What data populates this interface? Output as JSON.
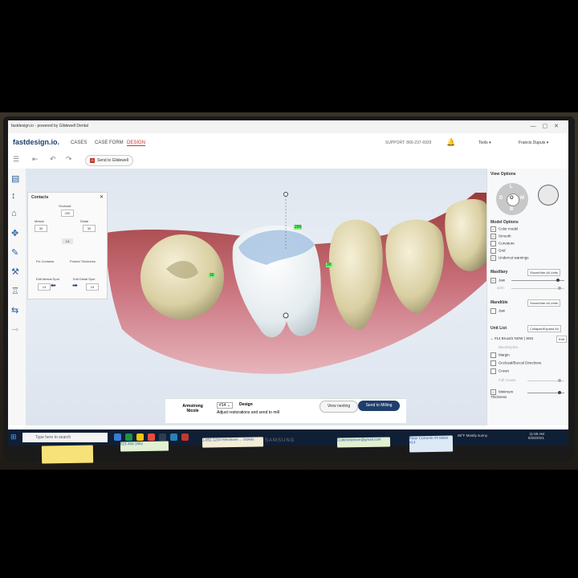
{
  "window": {
    "title": "fastdesign.io - powered by Glidewell Dental"
  },
  "app": {
    "logo": "fastdesign.io.",
    "tabs": [
      "CASES",
      "CASE FORM",
      "DESIGN"
    ],
    "active_tab": "DESIGN",
    "support": "SUPPORT: 866-237-6929",
    "tools": "Tools",
    "user": "Francis Dupuis"
  },
  "toolbar": {
    "send": "Send to Glidewell"
  },
  "contacts": {
    "title": "Contacts",
    "occlusal_label": "Occlusal",
    "occlusal_value": "200",
    "mesial_label": "Mesial",
    "mesial_value": "30",
    "distal_label": "Distal",
    "distal_value": "30",
    "center_value": "14",
    "fix_contacts": "Fix Contacts",
    "protect_thickness": "Protect Thickness",
    "edit_mesial": "Edit Mesial Spot",
    "edit_distal": "Edit Distal Spot",
    "mesial_spot": "13",
    "distal_spot": "15"
  },
  "viewport_labels": {
    "occlusal": "200",
    "mesial": "30",
    "distal": "30"
  },
  "right_panel": {
    "view_options": "View Options",
    "dial": {
      "top": "L",
      "left": "D",
      "center": "O",
      "right": "M",
      "bottom": "B"
    },
    "model_options": "Model Options",
    "model_items": [
      {
        "label": "Color model",
        "checked": true
      },
      {
        "label": "Smooth",
        "checked": true
      },
      {
        "label": "Curvature",
        "checked": false
      },
      {
        "label": "Grid",
        "checked": false
      },
      {
        "label": "Undercut warnings",
        "checked": true
      }
    ],
    "maxillary": "Maxillary",
    "maxillary_btn": "Show/Hide All Units",
    "maxillary_jaw": "Jaw",
    "maxillary_arch": "arch",
    "mandible": "Mandible",
    "mandible_btn": "Show/Hide All Units",
    "mandible_jaw": "Jaw",
    "unit_list": "Unit List",
    "collapse_btn": "Collapse/Expand All",
    "unit_name": "#14 BruxZir NOW | SM1",
    "edit": "Edit",
    "unit_items": [
      {
        "label": "Block/Splice",
        "checked": false,
        "dim": true
      },
      {
        "label": "Margin",
        "checked": false,
        "dim": false
      },
      {
        "label": "Occlusal/Buccal Directions",
        "checked": false,
        "dim": false
      },
      {
        "label": "Crown",
        "checked": false,
        "dim": false
      },
      {
        "label": "Full Crown",
        "checked": false,
        "dim": true
      },
      {
        "label": "Minimum Thickness",
        "checked": true,
        "dim": false
      }
    ]
  },
  "bottom": {
    "patient": "Armstrong Nicole",
    "tooth": "#14",
    "step": "Design",
    "instruction": "Adjust restorations and send to mill",
    "view_nesting": "View nesting",
    "send_mill": "Send to Milling"
  },
  "taskbar": {
    "search": "Type here to search",
    "weather": "88°F Mostly sunny",
    "time": "11:59 AM",
    "date": "8/26/2021"
  },
  "monitor": {
    "brand": "SAMSUNG"
  },
  "stickies": {
    "note1": "615-464-1982",
    "note2": "1-852-1234 Henriksen ... Stokes",
    "note3": "Cuttershannon@gmail.com",
    "note4": "Peter Colcomb #9 Molar #14"
  },
  "colors": {
    "accent": "#c0392b",
    "navy": "#1f3e6b",
    "label": "#7cf07c"
  }
}
